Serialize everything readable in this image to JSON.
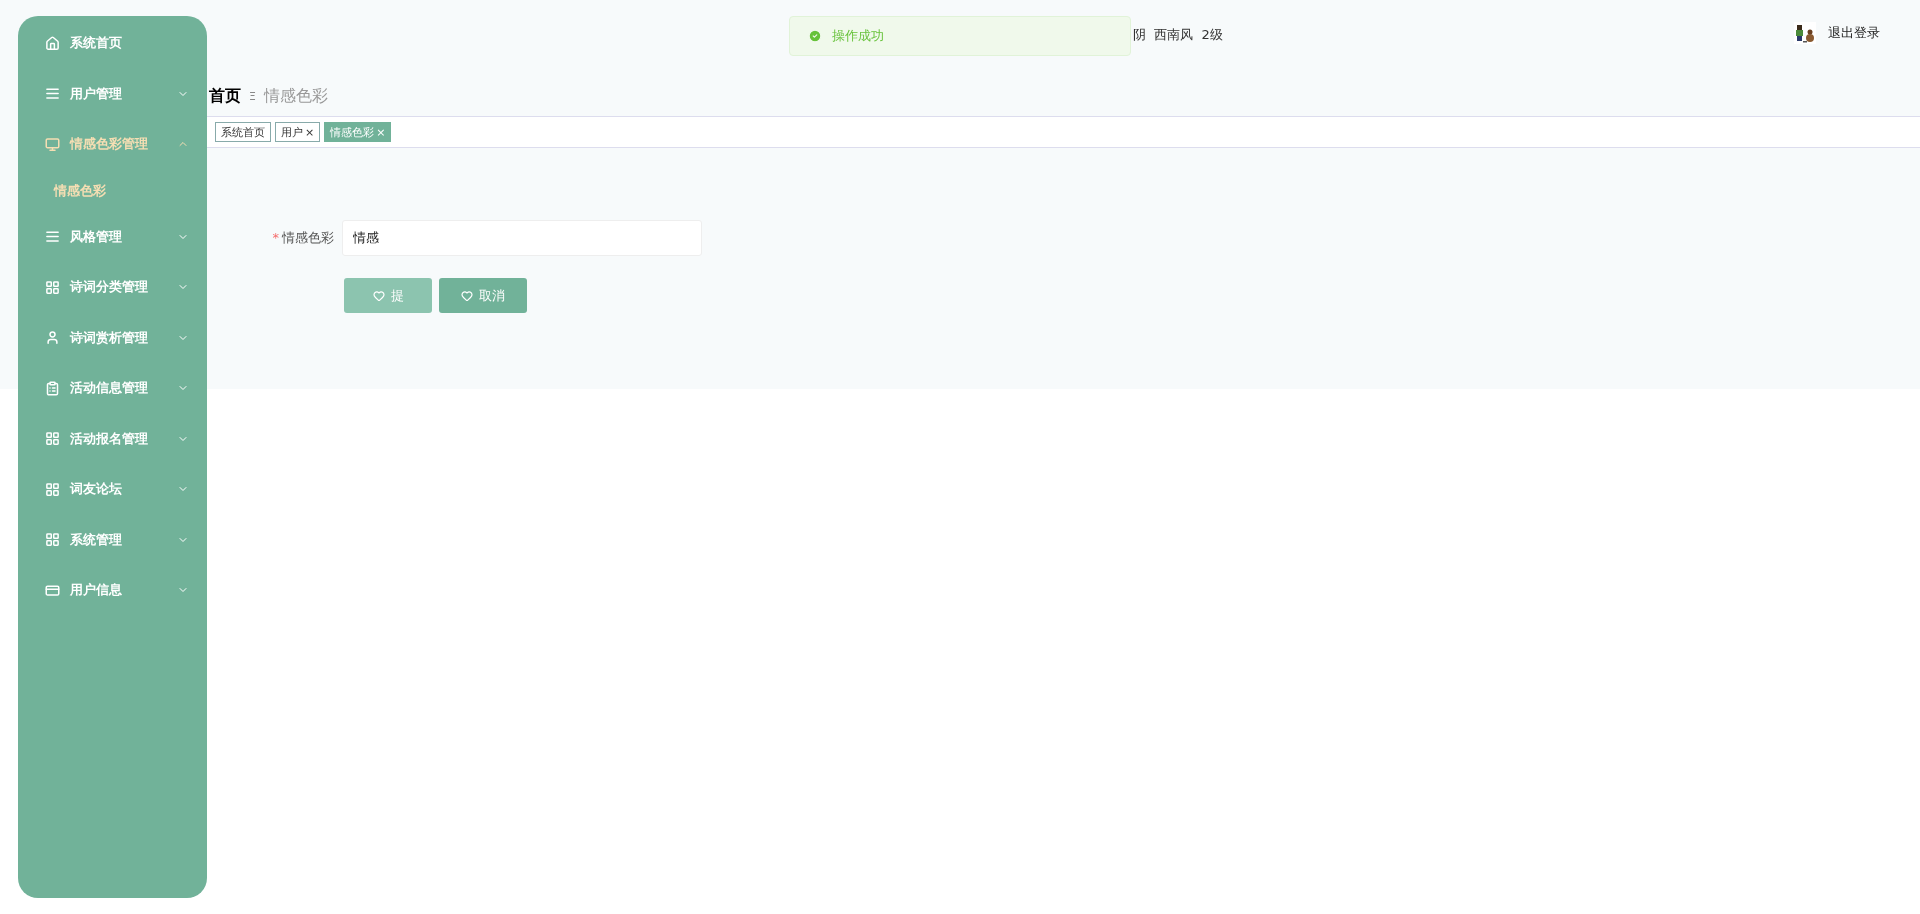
{
  "sidebar": {
    "items": [
      {
        "label": "系统首页",
        "kind": "home",
        "has_children": false,
        "expanded": false
      },
      {
        "label": "用户管理",
        "kind": "list",
        "has_children": true,
        "expanded": false
      },
      {
        "label": "情感色彩管理",
        "kind": "monitor",
        "has_children": true,
        "expanded": true,
        "children": [
          {
            "label": "情感色彩",
            "selected": true
          }
        ]
      },
      {
        "label": "风格管理",
        "kind": "list",
        "has_children": true,
        "expanded": false
      },
      {
        "label": "诗词分类管理",
        "kind": "grid",
        "has_children": true,
        "expanded": false
      },
      {
        "label": "诗词赏析管理",
        "kind": "user",
        "has_children": true,
        "expanded": false
      },
      {
        "label": "活动信息管理",
        "kind": "clipboard",
        "has_children": true,
        "expanded": false
      },
      {
        "label": "活动报名管理",
        "kind": "grid",
        "has_children": true,
        "expanded": false
      },
      {
        "label": "词友论坛",
        "kind": "grid",
        "has_children": true,
        "expanded": false
      },
      {
        "label": "系统管理",
        "kind": "grid",
        "has_children": true,
        "expanded": false
      },
      {
        "label": "用户信息",
        "kind": "card",
        "has_children": true,
        "expanded": false
      }
    ]
  },
  "toast": {
    "message": "操作成功"
  },
  "weather": "阴  西南风  2级",
  "header": {
    "logout": "退出登录"
  },
  "breadcrumb": {
    "items": [
      "首页",
      "情感色彩"
    ],
    "separator": "Ξ"
  },
  "tabs": [
    {
      "label": "系统首页",
      "closable": false,
      "selected": false
    },
    {
      "label": "用户",
      "closable": true,
      "selected": false
    },
    {
      "label": "情感色彩",
      "closable": true,
      "selected": true
    }
  ],
  "tab_close": "×",
  "form": {
    "fields": [
      {
        "label": "情感色彩",
        "required_mark": "*",
        "value": "情感"
      }
    ],
    "buttons": [
      {
        "label": "提",
        "hovered": true
      },
      {
        "label": "取消",
        "hovered": false
      }
    ]
  }
}
